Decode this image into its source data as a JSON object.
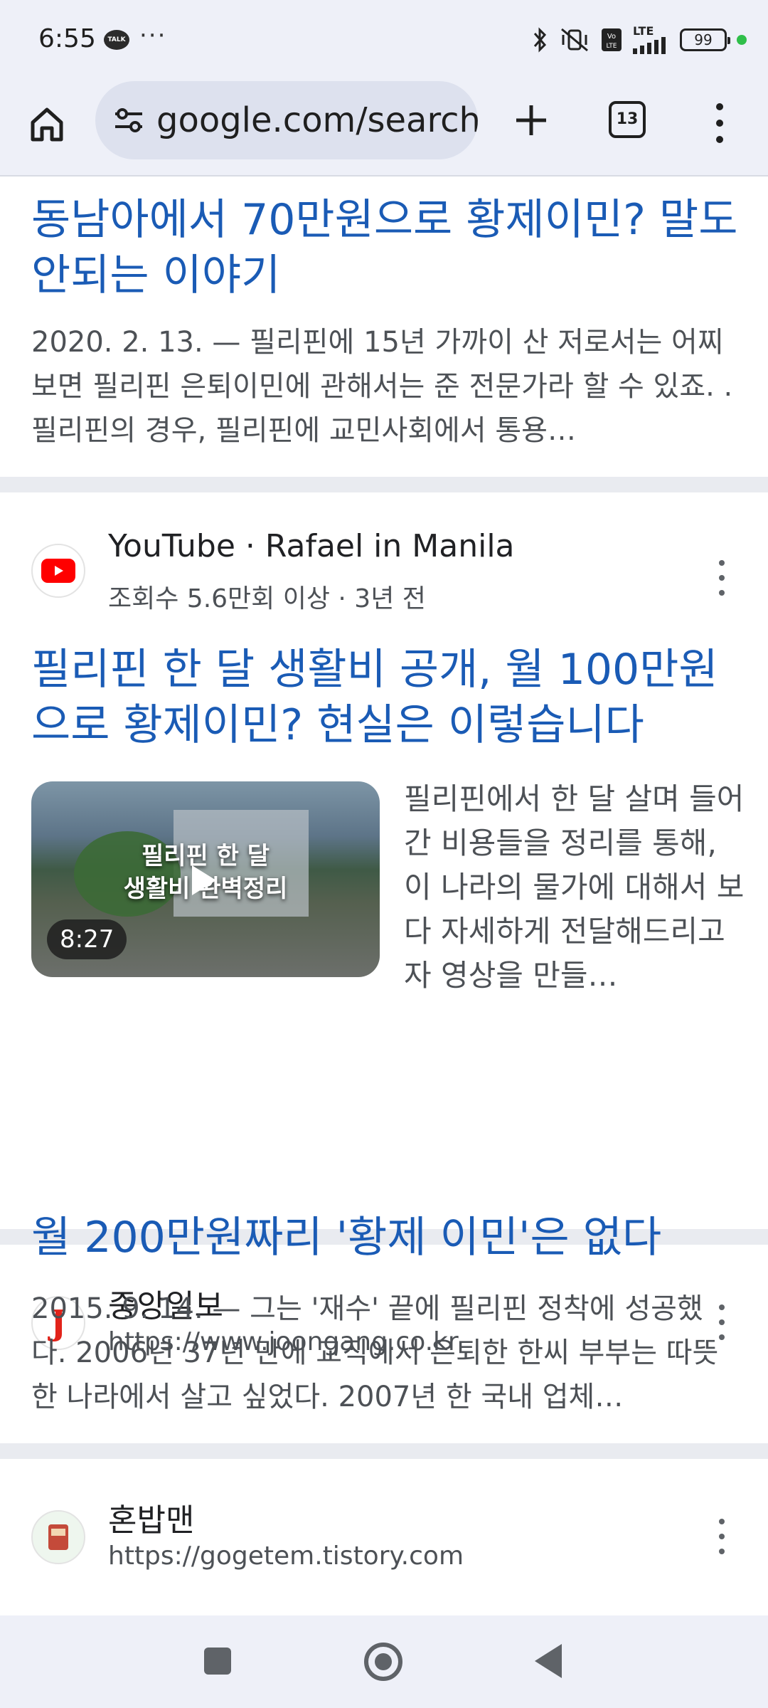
{
  "status_bar": {
    "time": "6:55",
    "talk_badge": "TALK",
    "overflow": "···",
    "network": "LTE",
    "battery": "99"
  },
  "toolbar": {
    "url": "google.com/search?",
    "tab_count": "13"
  },
  "results": [
    {
      "title": "동남아에서 70만원으로 황제이민? 말도 안되는 이야기",
      "snippet": "2020. 2. 13. — 필리핀에 15년 가까이 산 저로서는 어찌보면 필리핀 은퇴이민에 관해서는 준 전문가라 할 수 있죠. . 필리핀의 경우, 필리핀에 교민사회에서 통용…"
    },
    {
      "source": "YouTube · Rafael in Manila",
      "meta": "조회수 5.6만회 이상 · 3년 전",
      "title": "필리핀 한 달 생활비 공개, 월 100만원으로 황제이민? 현실은 이렇습니다",
      "thumb_text_1": "필리핀 한 달",
      "thumb_text_2": "생활비 완벽정리",
      "duration": "8:27",
      "snippet": "필리핀에서 한 달 살며 들어간 비용들을 정리를 통해, 이 나라의 물가에 대해서 보다 자세하게 전달해드리고자 영상을 만들…"
    },
    {
      "source": "중앙일보",
      "url": "https://www.joongang.co.kr",
      "favicon_letter": "J",
      "title": "월 200만원짜리 '황제 이민'은 없다",
      "snippet": "2015. 9. 14. — 그는 '재수' 끝에 필리핀 정착에 성공했다. 2006년 37년 만에 교직에서 은퇴한 한씨 부부는 따뜻한 나라에서 살고 싶었다. 2007년 한 국내 업체…"
    },
    {
      "source": "혼밥맨",
      "url": "https://gogetem.tistory.com"
    }
  ],
  "colors": {
    "link": "#1a5bb5",
    "chrome_bg": "#eef0f8",
    "separator": "#e9ebf0"
  }
}
